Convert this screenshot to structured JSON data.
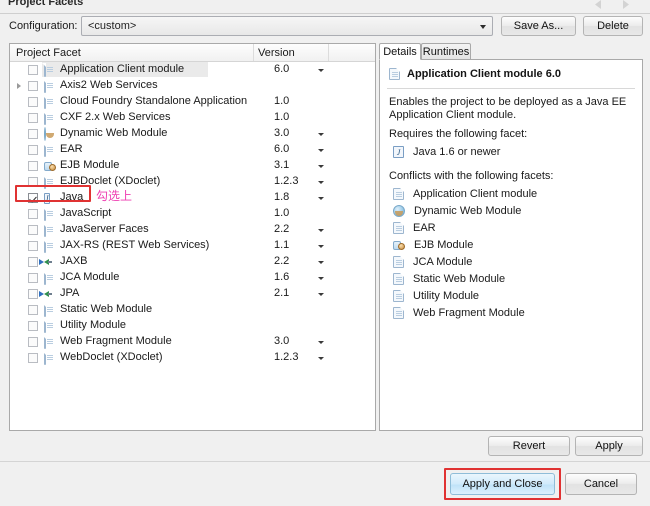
{
  "window": {
    "title": "Project Facets",
    "nav_back_icon": "nav-back-icon",
    "nav_forward_icon": "nav-forward-icon"
  },
  "configuration": {
    "label": "Configuration:",
    "value": "<custom>",
    "dropdown_icon": "chevron-down-icon",
    "save_as_label": "Save As...",
    "delete_label": "Delete"
  },
  "facet_table": {
    "columns": [
      "Project Facet",
      "Version",
      ""
    ],
    "rows": [
      {
        "label": "Application Client module",
        "version": "6.0",
        "checked": false,
        "selected": true,
        "has_version_dropdown": true,
        "expandable": false,
        "icon": "doc-icon"
      },
      {
        "label": "Axis2 Web Services",
        "version": "",
        "checked": false,
        "selected": false,
        "has_version_dropdown": false,
        "expandable": true,
        "icon": "doc-icon"
      },
      {
        "label": "Cloud Foundry Standalone Application",
        "version": "1.0",
        "checked": false,
        "selected": false,
        "has_version_dropdown": false,
        "expandable": false,
        "icon": "doc-icon"
      },
      {
        "label": "CXF 2.x Web Services",
        "version": "1.0",
        "checked": false,
        "selected": false,
        "has_version_dropdown": false,
        "expandable": false,
        "icon": "doc-icon"
      },
      {
        "label": "Dynamic Web Module",
        "version": "3.0",
        "checked": false,
        "selected": false,
        "has_version_dropdown": true,
        "expandable": false,
        "icon": "globe-icon"
      },
      {
        "label": "EAR",
        "version": "6.0",
        "checked": false,
        "selected": false,
        "has_version_dropdown": true,
        "expandable": false,
        "icon": "doc-icon"
      },
      {
        "label": "EJB Module",
        "version": "3.1",
        "checked": false,
        "selected": false,
        "has_version_dropdown": true,
        "expandable": false,
        "icon": "bean-icon"
      },
      {
        "label": "EJBDoclet (XDoclet)",
        "version": "1.2.3",
        "checked": false,
        "selected": false,
        "has_version_dropdown": true,
        "expandable": false,
        "icon": "doc-icon"
      },
      {
        "label": "Java",
        "version": "1.8",
        "checked": true,
        "selected": false,
        "has_version_dropdown": true,
        "expandable": false,
        "icon": "java-icon"
      },
      {
        "label": "JavaScript",
        "version": "1.0",
        "checked": false,
        "selected": false,
        "has_version_dropdown": false,
        "expandable": false,
        "icon": "doc-icon"
      },
      {
        "label": "JavaServer Faces",
        "version": "2.2",
        "checked": false,
        "selected": false,
        "has_version_dropdown": true,
        "expandable": false,
        "icon": "doc-icon"
      },
      {
        "label": "JAX-RS (REST Web Services)",
        "version": "1.1",
        "checked": false,
        "selected": false,
        "has_version_dropdown": true,
        "expandable": false,
        "icon": "doc-icon"
      },
      {
        "label": "JAXB",
        "version": "2.2",
        "checked": false,
        "selected": false,
        "has_version_dropdown": true,
        "expandable": false,
        "icon": "arrows-icon"
      },
      {
        "label": "JCA Module",
        "version": "1.6",
        "checked": false,
        "selected": false,
        "has_version_dropdown": true,
        "expandable": false,
        "icon": "doc-icon"
      },
      {
        "label": "JPA",
        "version": "2.1",
        "checked": false,
        "selected": false,
        "has_version_dropdown": true,
        "expandable": false,
        "icon": "arrows-icon"
      },
      {
        "label": "Static Web Module",
        "version": "",
        "checked": false,
        "selected": false,
        "has_version_dropdown": false,
        "expandable": false,
        "icon": "doc-icon"
      },
      {
        "label": "Utility Module",
        "version": "",
        "checked": false,
        "selected": false,
        "has_version_dropdown": false,
        "expandable": false,
        "icon": "doc-icon"
      },
      {
        "label": "Web Fragment Module",
        "version": "3.0",
        "checked": false,
        "selected": false,
        "has_version_dropdown": true,
        "expandable": false,
        "icon": "doc-icon"
      },
      {
        "label": "WebDoclet (XDoclet)",
        "version": "1.2.3",
        "checked": false,
        "selected": false,
        "has_version_dropdown": true,
        "expandable": false,
        "icon": "doc-icon"
      }
    ]
  },
  "annotations": {
    "java_note": "勾选上",
    "note_color": "#ee3db1",
    "highlight_color": "#e03232"
  },
  "details": {
    "tabs": [
      {
        "label": "Details",
        "active": true
      },
      {
        "label": "Runtimes",
        "active": false
      }
    ],
    "heading": "Application Client module 6.0",
    "heading_icon": "doc-icon",
    "description": "Enables the project to be deployed as a Java EE Application Client module.",
    "requires_label": "Requires the following facet:",
    "requires": [
      {
        "label": "Java 1.6 or newer",
        "icon": "java-icon"
      }
    ],
    "conflicts_label": "Conflicts with the following facets:",
    "conflicts": [
      {
        "label": "Application Client module",
        "icon": "doc-icon"
      },
      {
        "label": "Dynamic Web Module",
        "icon": "globe-icon"
      },
      {
        "label": "EAR",
        "icon": "doc-icon"
      },
      {
        "label": "EJB Module",
        "icon": "bean-icon"
      },
      {
        "label": "JCA Module",
        "icon": "doc-icon"
      },
      {
        "label": "Static Web Module",
        "icon": "doc-icon"
      },
      {
        "label": "Utility Module",
        "icon": "doc-icon"
      },
      {
        "label": "Web Fragment Module",
        "icon": "doc-icon"
      }
    ]
  },
  "buttons": {
    "revert": "Revert",
    "apply": "Apply",
    "apply_and_close": "Apply and Close",
    "cancel": "Cancel"
  }
}
